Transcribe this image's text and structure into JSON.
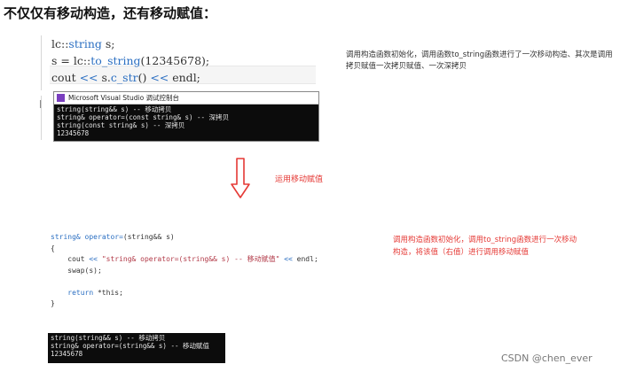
{
  "title": "不仅仅有移动构造，还有移动赋值：",
  "code_top": {
    "lines": [
      {
        "pre": "lc::",
        "ident": "string",
        "post": " s;"
      },
      {
        "pre": "s = lc::",
        "ident": "to_string",
        "post": "(12345678);"
      },
      {
        "pre": "cout ",
        "op": "<<",
        "mid": " s.",
        "ident": "c_str",
        "post2": "() ",
        "op2": "<<",
        "post": " endl;"
      }
    ]
  },
  "console_top": {
    "window_title": "Microsoft Visual Studio 调试控制台",
    "output": "string(string&& s) -- 移动拷贝\nstring& operator=(const string& s) -- 深拷贝\nstring(const string& s) -- 深拷贝\n12345678"
  },
  "note_top": "调用构造函数初始化，调用函数to_string函数进行了一次移动构造、其次是调用拷贝赋值一次拷贝赋值、一次深拷贝",
  "arrow_label": "运用移动赋值",
  "code_bottom": {
    "l1_type": "string&",
    "l1_fn": "operator=",
    "l1_param_type": "(string&&",
    "l1_param": " s)",
    "l2": "{",
    "l3_pre": "    cout ",
    "l3_op": "<<",
    "l3_str": " \"string& operator=(string&& s) -- 移动赋值\" ",
    "l3_op2": "<<",
    "l3_post": " endl;",
    "l4": "    swap(s);",
    "l5_kw": "    return",
    "l5_post": " *this;",
    "l6": "}"
  },
  "note_bottom": "调用构造函数初始化，调用to_string函数进行一次移动构造，将该值（右值）进行调用移动赋值",
  "console_bottom": {
    "output": "string(string&& s) -- 移动拷贝\nstring& operator=(string&& s) -- 移动赋值\n12345678"
  },
  "watermark": "CSDN @chen_ever",
  "colors": {
    "accent_red": "#e53935",
    "keyword_blue": "#2b6fc2",
    "console_bg": "#0c0c0c"
  }
}
